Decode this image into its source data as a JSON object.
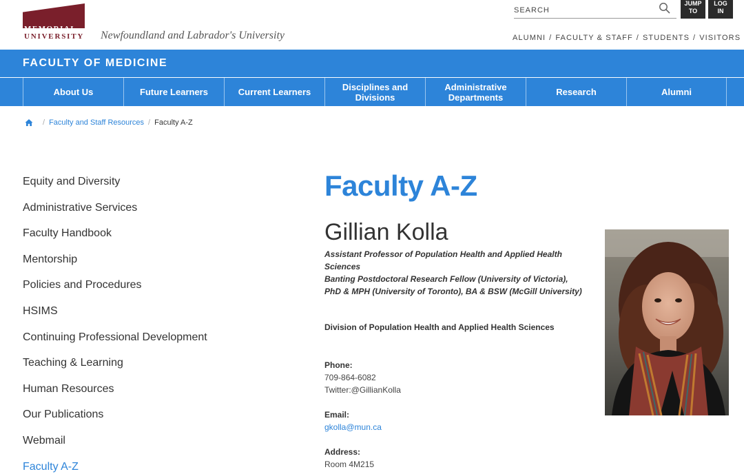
{
  "header": {
    "logo_line1": "MEMORIAL",
    "logo_line2": "UNIVERSITY",
    "tagline": "Newfoundland and Labrador's University",
    "search_placeholder": "SEARCH",
    "jump_to": [
      "JUMP",
      "TO"
    ],
    "log_in": [
      "LOG",
      "IN"
    ],
    "audience_links": [
      "ALUMNI",
      "FACULTY & STAFF",
      "STUDENTS",
      "VISITORS"
    ]
  },
  "faculty": {
    "title": "FACULTY OF MEDICINE"
  },
  "nav": [
    {
      "label": "About Us"
    },
    {
      "label": "Future Learners"
    },
    {
      "label": "Current Learners"
    },
    {
      "label": "Disciplines and Divisions"
    },
    {
      "label": "Administrative Departments"
    },
    {
      "label": "Research"
    },
    {
      "label": "Alumni"
    }
  ],
  "breadcrumb": {
    "items": [
      "Faculty and Staff Resources",
      "Faculty A-Z"
    ]
  },
  "sidebar": {
    "items": [
      "Equity and Diversity",
      "Administrative Services",
      "Faculty Handbook",
      "Mentorship",
      "Policies and Procedures",
      "HSIMS",
      "Continuing Professional Development",
      "Teaching & Learning",
      "Human Resources",
      "Our Publications",
      "Webmail",
      "Faculty A-Z"
    ],
    "active_index": 11
  },
  "main": {
    "page_title": "Faculty A-Z",
    "name": "Gillian Kolla",
    "title_lines": [
      "Assistant Professor of Population Health and Applied Health Sciences",
      "Banting Postdoctoral Research Fellow (University of Victoria), PhD & MPH (University of Toronto), BA & BSW (McGill University)"
    ],
    "division": "Division of Population Health and Applied Health Sciences",
    "phone_label": "Phone:",
    "phone": "709-864-6082",
    "twitter": "Twitter:@GillianKolla",
    "email_label": "Email:",
    "email": "gkolla@mun.ca",
    "address_label": "Address:",
    "address": "Room 4M215"
  },
  "colors": {
    "brand_blue": "#2d84d9",
    "mun_maroon": "#7a1f2b"
  }
}
